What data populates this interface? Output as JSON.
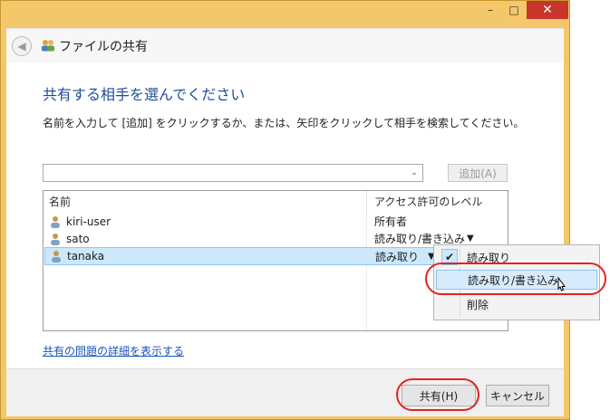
{
  "window": {
    "title": "ファイルの共有",
    "minimize_label": "–",
    "maximize_label": "□",
    "close_label": "✕"
  },
  "nav": {
    "back_icon": "back-arrow-icon",
    "back_glyph": "◀"
  },
  "dialog": {
    "heading": "共有する相手を選んでください",
    "instruction": "名前を入力して [追加] をクリックするか、または、矢印をクリックして相手を検索してください。",
    "combo_value": "",
    "combo_arrow": "⌄",
    "add_button": "追加(A)",
    "columns": {
      "name": "名前",
      "level": "アクセス許可のレベル"
    },
    "rows": [
      {
        "name": "kiri-user",
        "level": "所有者",
        "dropdown": ""
      },
      {
        "name": "sato",
        "level": "読み取り/書き込み",
        "dropdown": "▼"
      },
      {
        "name": "tanaka",
        "level": "読み取り",
        "dropdown": "▼"
      }
    ],
    "help_link": "共有の問題の詳細を表示する",
    "share_button": "共有(H)",
    "cancel_button": "キャンセル"
  },
  "context_menu": {
    "items": [
      {
        "label": "読み取り",
        "checked": true,
        "check_glyph": "✔"
      },
      {
        "label": "読み取り/書き込み",
        "checked": false
      },
      {
        "label": "削除",
        "checked": false
      }
    ]
  },
  "colors": {
    "frame": "#f5c76b",
    "heading": "#1e4d9a",
    "link": "#1a55b8",
    "selection": "#cde8fb",
    "annotation": "#e2241f",
    "close": "#c7352b"
  }
}
